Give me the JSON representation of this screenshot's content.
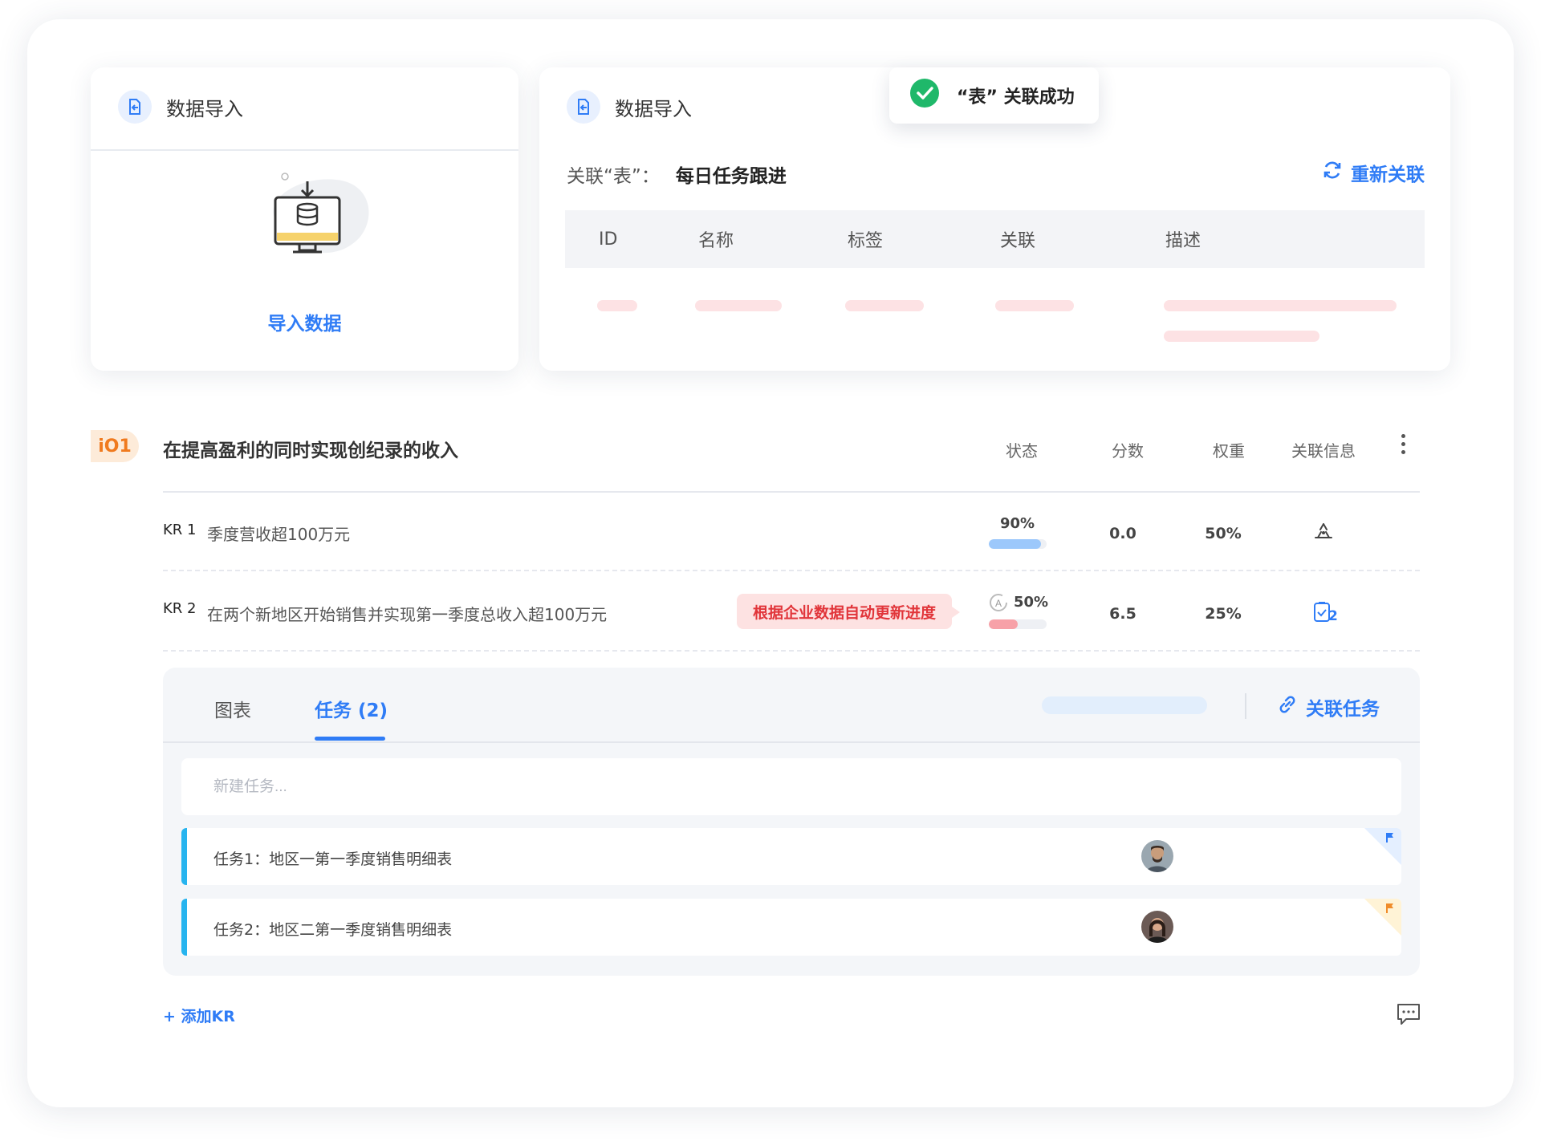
{
  "import_card": {
    "title": "数据导入",
    "action_label": "导入数据"
  },
  "link_card": {
    "title": "数据导入",
    "relation_label": "关联“表”：",
    "relation_value": "每日任务跟进",
    "relink_label": "重新关联",
    "columns": [
      "ID",
      "名称",
      "标签",
      "关联",
      "描述"
    ]
  },
  "toast": {
    "message": "“表” 关联成功",
    "icon": "check-circle-icon"
  },
  "objective": {
    "badge": "iO1",
    "title": "在提高盈利的同时实现创纪录的收入",
    "columns": {
      "status": "状态",
      "score": "分数",
      "weight": "权重",
      "related": "关联信息"
    },
    "key_results": [
      {
        "no": "KR 1",
        "text": "季度营收超100万元",
        "progress_label": "90%",
        "progress": 0.9,
        "bar_color": "#9cc8fb",
        "score": "0.0",
        "weight": "50%",
        "related_icon": "recycle-link-icon"
      },
      {
        "no": "KR 2",
        "text": "在两个新地区开始销售并实现第一季度总收入超100万元",
        "auto_update_note": "根据企业数据自动更新进度",
        "progress_label": "50%",
        "progress": 0.5,
        "bar_color": "#f7a1a8",
        "score": "6.5",
        "weight": "25%",
        "related_icon": "clipboard-task-icon",
        "related_count": "2"
      }
    ],
    "tabs": {
      "chart": "图表",
      "tasks": "任务 (2)"
    },
    "link_task_label": "关联任务",
    "new_task_placeholder": "新建任务...",
    "tasks": [
      {
        "text": "任务1：地区一第一季度销售明细表",
        "flag_color": "#2f7cf6",
        "corner_color": "#e4efff"
      },
      {
        "text": "任务2：地区二第一季度销售明细表",
        "flag_color": "#f08c2a",
        "corner_color": "#fff3d6"
      }
    ],
    "add_kr_label": "+ 添加KR"
  },
  "colors": {
    "accent": "#2f7cf6",
    "task_stripe": "#27b4ef",
    "warn_text": "#e1353a"
  }
}
